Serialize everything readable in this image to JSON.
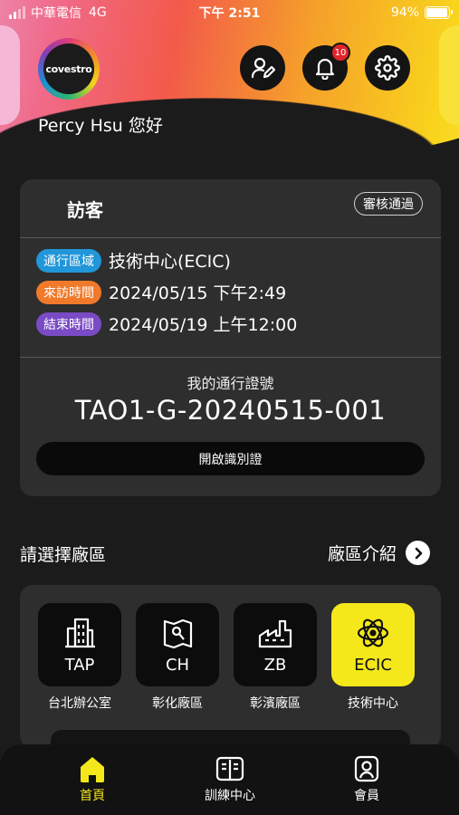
{
  "status_bar": {
    "carrier": "中華電信",
    "network": "4G",
    "time": "下午 2:51",
    "battery_text": "94%",
    "battery_level": 0.94
  },
  "header": {
    "logo_text": "covestro",
    "greeting": "Percy Hsu 您好",
    "notification_count": "10",
    "icons": [
      "edit-profile-icon",
      "bell-icon",
      "gear-icon"
    ]
  },
  "visitor_card": {
    "title": "訪客",
    "status": "審核通過",
    "rows": [
      {
        "tag": "通行區域",
        "value": "技術中心(ECIC)",
        "color": "#2196d9"
      },
      {
        "tag": "來訪時間",
        "value": "2024/05/15 下午2:49",
        "color": "#f07a2a"
      },
      {
        "tag": "結束時間",
        "value": "2024/05/19 上午12:00",
        "color": "#7a4bc4"
      }
    ],
    "pass_label": "我的通行證號",
    "pass_number": "TAO1-G-20240515-001",
    "open_button": "開啟識別證"
  },
  "plant_section": {
    "title": "請選擇廠區",
    "link": "廠區介紹",
    "plants": [
      {
        "code": "TAP",
        "name": "台北辦公室",
        "icon": "office-building-icon",
        "active": false
      },
      {
        "code": "CH",
        "name": "彰化廠區",
        "icon": "map-icon",
        "active": false
      },
      {
        "code": "ZB",
        "name": "彰濱廠區",
        "icon": "factory-icon",
        "active": false
      },
      {
        "code": "ECIC",
        "name": "技術中心",
        "icon": "atom-icon",
        "active": true
      }
    ]
  },
  "bottom_nav": {
    "items": [
      {
        "label": "首頁",
        "icon": "home-icon",
        "active": true
      },
      {
        "label": "訓練中心",
        "icon": "book-icon",
        "active": false
      },
      {
        "label": "會員",
        "icon": "member-icon",
        "active": false
      }
    ]
  },
  "colors": {
    "accent_yellow": "#f5e81a",
    "card_bg": "#2e2e2e",
    "page_bg": "#1b1b1b"
  }
}
